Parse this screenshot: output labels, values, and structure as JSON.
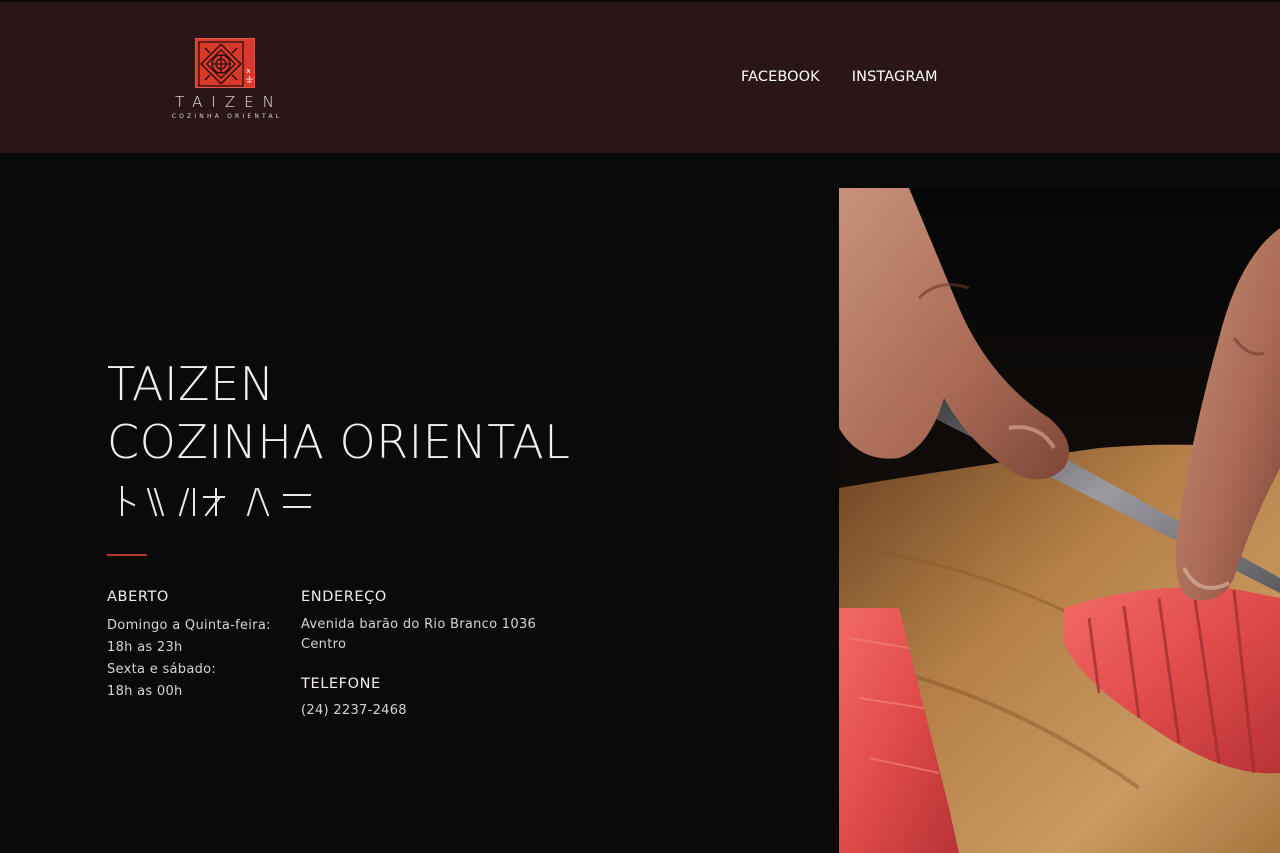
{
  "header": {
    "logo": {
      "name": "TAIZEN",
      "subtitle": "COZINHA ORIENTAL",
      "mark_color": "#d8392b"
    },
    "nav": [
      {
        "label": "FACEBOOK"
      },
      {
        "label": "INSTAGRAM"
      }
    ]
  },
  "hero": {
    "title_line1": "TAIZEN",
    "title_line2": "COZINHA ORIENTAL",
    "decorative_glyphs": "ト∖∖ /|才/\\=",
    "accent_color": "#b9392c"
  },
  "info": {
    "hours": {
      "heading": "ABERTO",
      "lines": [
        "Domingo a Quinta-feira:",
        "18h as 23h",
        "Sexta e sábado:",
        "18h as 00h"
      ]
    },
    "address": {
      "heading": "ENDEREÇO",
      "lines": [
        "Avenida barão do Rio Branco 1036",
        "Centro"
      ]
    },
    "phone": {
      "heading": "TELEFONE",
      "value": "(24) 2237-2468"
    }
  },
  "photo": {
    "icon": "sushi-photo"
  }
}
